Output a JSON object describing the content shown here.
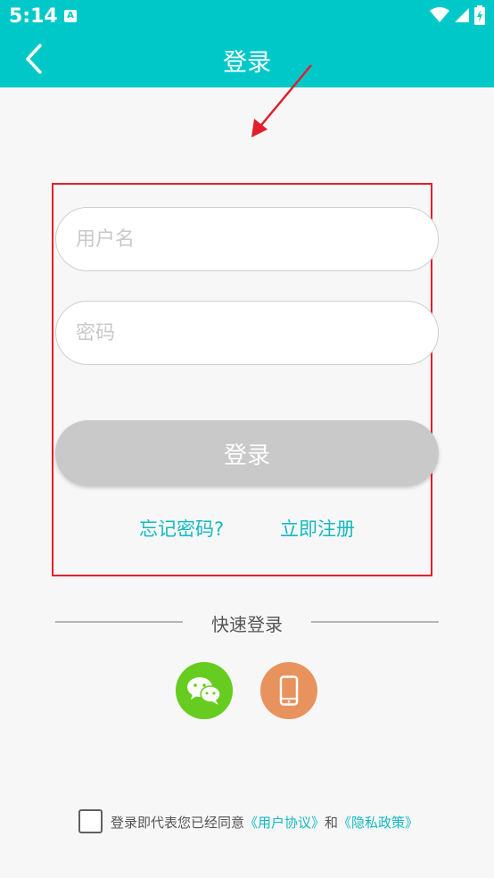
{
  "status_bar": {
    "time": "5:14",
    "notification_letter": "A"
  },
  "header": {
    "title": "登录"
  },
  "form": {
    "username_placeholder": "用户名",
    "password_placeholder": "密码",
    "login_label": "登录",
    "forgot_label": "忘记密码?",
    "register_label": "立即注册"
  },
  "quick_login": {
    "label": "快速登录"
  },
  "agreement": {
    "prefix": "登录即代表您已经同意",
    "user_agreement": "《用户协议》",
    "conjunction": "和",
    "privacy_policy": "《隐私政策》",
    "checked": false
  },
  "colors": {
    "brand": "#00c8c8",
    "link": "#13b9c2",
    "annotation": "#e0202c",
    "wechat": "#66cc1f",
    "phone": "#e8935e"
  },
  "icons": [
    "back-icon",
    "wifi-icon",
    "signal-icon",
    "battery-icon",
    "wechat-icon",
    "phone-icon"
  ]
}
